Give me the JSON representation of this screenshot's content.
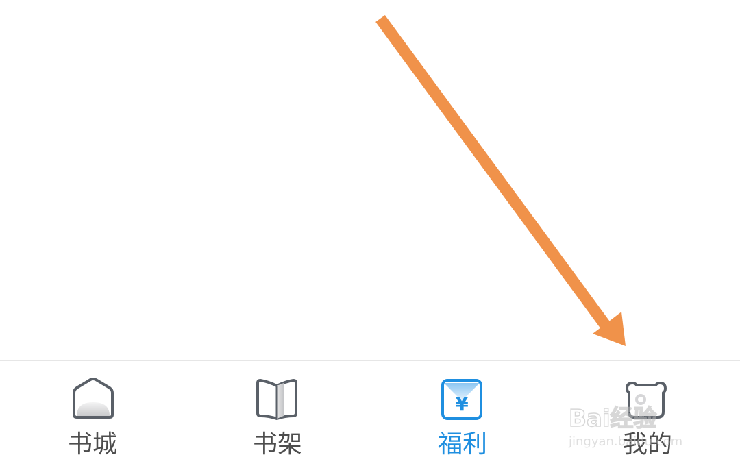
{
  "tabbar": {
    "tabs": [
      {
        "label": "书城",
        "icon": "home-icon",
        "active": false
      },
      {
        "label": "书架",
        "icon": "book-icon",
        "active": false
      },
      {
        "label": "福利",
        "icon": "yen-icon",
        "active": true
      },
      {
        "label": "我的",
        "icon": "profile-icon",
        "active": false
      }
    ]
  },
  "annotation": {
    "color": "#f0924a",
    "icon": "arrow-icon"
  },
  "watermark": {
    "brand": "Bai经验",
    "url": "jingyan.baidu.com"
  },
  "colors": {
    "active": "#1f8fe0",
    "inactive": "#4d4d4d",
    "icon_stroke": "#5a6068"
  }
}
